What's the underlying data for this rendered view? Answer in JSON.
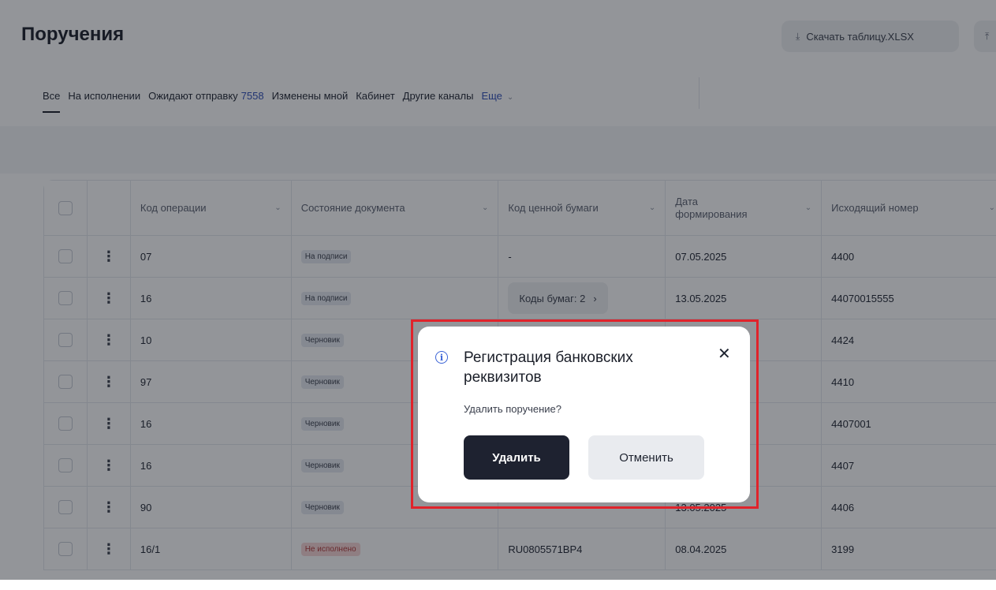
{
  "header": {
    "title": "Поручения",
    "download_label": "Скачать таблицу.XLSX"
  },
  "tabs": [
    {
      "label": "Все",
      "active": true
    },
    {
      "label": "На исполнении"
    },
    {
      "label": "Ожидают отправку",
      "count": "7558"
    },
    {
      "label": "Изменены мной"
    },
    {
      "label": "Кабинет"
    },
    {
      "label": "Другие каналы"
    },
    {
      "label": "Еще",
      "more": true
    }
  ],
  "table": {
    "columns": [
      "Код операции",
      "Состояние документа",
      "Код ценной бумаги",
      "Дата формирования",
      "Исходящий номер"
    ],
    "rows": [
      {
        "code": "07",
        "state": "На подписи",
        "security": "-",
        "date": "07.05.2025",
        "outgoing": "4400"
      },
      {
        "code": "16",
        "state": "На подписи",
        "security": "Коды бумаг: 2",
        "security_button": true,
        "date": "13.05.2025",
        "outgoing": "44070015555"
      },
      {
        "code": "10",
        "state": "Черновик",
        "security": "",
        "date": "",
        "outgoing": "4424"
      },
      {
        "code": "97",
        "state": "Черновик",
        "security": "",
        "date": "",
        "outgoing": "4410"
      },
      {
        "code": "16",
        "state": "Черновик",
        "security": "",
        "date": "",
        "outgoing": "4407001"
      },
      {
        "code": "16",
        "state": "Черновик",
        "security": "",
        "date": "",
        "outgoing": "4407"
      },
      {
        "code": "90",
        "state": "Черновик",
        "security": "-",
        "date": "13.05.2025",
        "outgoing": "4406"
      },
      {
        "code": "16/1",
        "state": "Не исполнено",
        "state_status": "error",
        "security": "RU0805571BP4",
        "date": "08.04.2025",
        "outgoing": "3199"
      }
    ]
  },
  "modal": {
    "title": "Регистрация банковских реквизитов",
    "message": "Удалить поручение?",
    "delete_label": "Удалить",
    "cancel_label": "Отменить"
  },
  "colors": {
    "accent": "#2f4eb8",
    "primary_button": "#1e2230",
    "highlight": "#e0232b"
  },
  "icons": {
    "download": "download-icon",
    "upload": "upload-icon",
    "info": "info-icon",
    "close": "close-icon",
    "row_menu": "kebab-menu-icon",
    "sort": "chevron-down-icon"
  }
}
